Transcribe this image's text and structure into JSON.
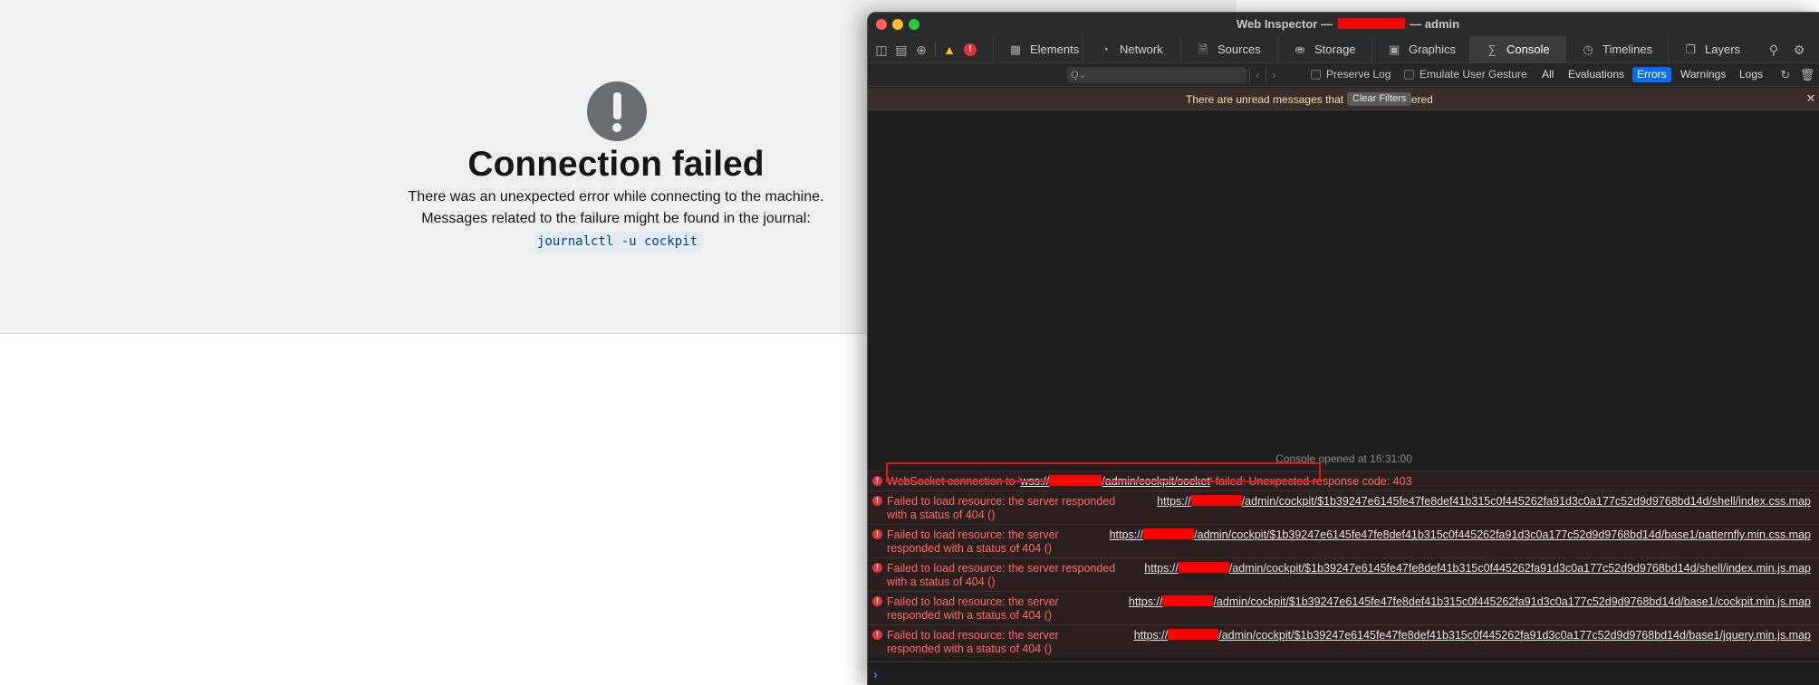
{
  "page": {
    "title": "Connection failed",
    "line1": "There was an unexpected error while connecting to the machine.",
    "line2": "Messages related to the failure might be found in the journal:",
    "command": "journalctl -u cockpit"
  },
  "inspector": {
    "title_prefix": "Web Inspector —",
    "title_suffix": "— admin",
    "tabs": [
      {
        "label": "Elements",
        "icon": "elements-icon"
      },
      {
        "label": "Network",
        "icon": "network-icon"
      },
      {
        "label": "Sources",
        "icon": "sources-icon"
      },
      {
        "label": "Storage",
        "icon": "storage-icon"
      },
      {
        "label": "Graphics",
        "icon": "graphics-icon"
      },
      {
        "label": "Console",
        "icon": "console-icon",
        "active": true
      },
      {
        "label": "Timelines",
        "icon": "timelines-icon"
      },
      {
        "label": "Layers",
        "icon": "layers-icon"
      }
    ],
    "filter": {
      "search_placeholder": "Q⌄",
      "preserve_log": "Preserve Log",
      "emulate_gesture": "Emulate User Gesture",
      "levels": [
        "All",
        "Evaluations",
        "Errors",
        "Warnings",
        "Logs"
      ],
      "active_level": "Errors"
    },
    "banner": {
      "text": "There are unread messages that have been filtered",
      "button": "Clear Filters"
    },
    "console_opened": "Console opened at 16:31:00",
    "messages": [
      {
        "pre": "WebSocket connection to '",
        "scheme": "wss://",
        "path": "/admin/cockpit/socket",
        "post": "' failed: Unexpected response code: 403"
      },
      {
        "text": "Failed to load resource: the server responded with a status of 404 ()",
        "url_scheme": "https://",
        "url_path": "/admin/cockpit/$1b39247e6145fe47fe8def41b315c0f445262fa91d3c0a177c52d9d9768bd14d/shell/index.css.map"
      },
      {
        "text": "Failed to load resource: the server responded with a status of 404 ()",
        "url_scheme": "https://",
        "url_path": "/admin/cockpit/$1b39247e6145fe47fe8def41b315c0f445262fa91d3c0a177c52d9d9768bd14d/base1/patternfly.min.css.map"
      },
      {
        "text": "Failed to load resource: the server responded with a status of 404 ()",
        "url_scheme": "https://",
        "url_path": "/admin/cockpit/$1b39247e6145fe47fe8def41b315c0f445262fa91d3c0a177c52d9d9768bd14d/shell/index.min.js.map"
      },
      {
        "text": "Failed to load resource: the server responded with a status of 404 ()",
        "url_scheme": "https://",
        "url_path": "/admin/cockpit/$1b39247e6145fe47fe8def41b315c0f445262fa91d3c0a177c52d9d9768bd14d/base1/cockpit.min.js.map"
      },
      {
        "text": "Failed to load resource: the server responded with a status of 404 ()",
        "url_scheme": "https://",
        "url_path": "/admin/cockpit/$1b39247e6145fe47fe8def41b315c0f445262fa91d3c0a177c52d9d9768bd14d/base1/jquery.min.js.map"
      }
    ],
    "colors": {
      "error_text": "#ff6b5f",
      "accent": "#0a6cf5",
      "redaction": "#ff0000"
    }
  }
}
